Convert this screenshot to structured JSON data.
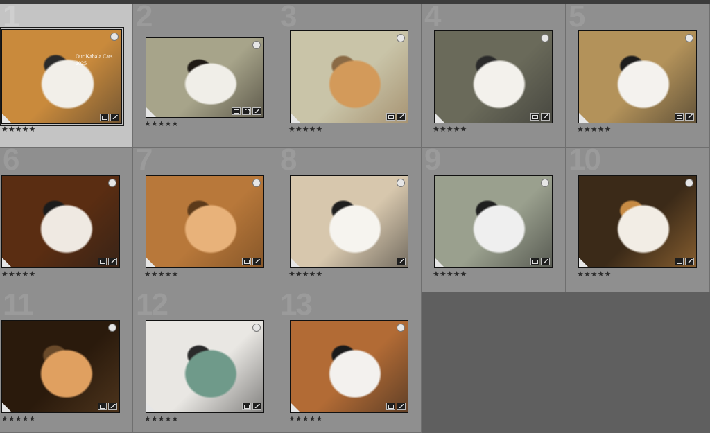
{
  "grid": {
    "cells": [
      {
        "num": "1",
        "rating": "★★★★★",
        "selected": true,
        "caption": [
          "Our Kahala Cats",
          "2025"
        ],
        "badges": [
          "crop",
          "edit"
        ],
        "palette": [
          "#c98a3c",
          "#f2efe9",
          "#2a2a2a"
        ]
      },
      {
        "num": "2",
        "rating": "★★★★★",
        "badges": [
          "crop",
          "extra",
          "edit"
        ],
        "palette": [
          "#a7a48a",
          "#f0eee8",
          "#1f1a15"
        ]
      },
      {
        "num": "3",
        "rating": "★★★★★",
        "badges": [
          "crop",
          "edit"
        ],
        "palette": [
          "#c9c4a8",
          "#d39a5a",
          "#8a6a45"
        ]
      },
      {
        "num": "4",
        "rating": "★★★★★",
        "badges": [
          "crop",
          "edit"
        ],
        "palette": [
          "#6a6a5a",
          "#f3f1ec",
          "#2a2a2a"
        ]
      },
      {
        "num": "5",
        "rating": "★★★★★",
        "badges": [
          "crop",
          "edit"
        ],
        "palette": [
          "#b3925a",
          "#f4f2ee",
          "#1c1c1c"
        ]
      },
      {
        "num": "6",
        "rating": "★★★★★",
        "badges": [
          "crop",
          "edit"
        ],
        "palette": [
          "#5a2d12",
          "#efe9e2",
          "#1b1b1b"
        ]
      },
      {
        "num": "7",
        "rating": "★★★★★",
        "badges": [
          "crop",
          "edit"
        ],
        "palette": [
          "#b8783a",
          "#e8b27a",
          "#5c3a1a"
        ]
      },
      {
        "num": "8",
        "rating": "★★★★★",
        "badges": [
          "edit"
        ],
        "palette": [
          "#d7c7ad",
          "#f6f4ef",
          "#1f1f1f"
        ]
      },
      {
        "num": "9",
        "rating": "★★★★★",
        "badges": [
          "crop",
          "edit"
        ],
        "palette": [
          "#9aa08e",
          "#efefef",
          "#1f1f1f"
        ]
      },
      {
        "num": "10",
        "rating": "★★★★★",
        "badges": [
          "crop",
          "edit"
        ],
        "palette": [
          "#3b2a18",
          "#f2ede5",
          "#c78b44"
        ]
      },
      {
        "num": "11",
        "rating": "★★★★★",
        "badges": [
          "crop",
          "edit"
        ],
        "palette": [
          "#2a1a0c",
          "#e0a060",
          "#6a4a2a"
        ]
      },
      {
        "num": "12",
        "rating": "★★★★★",
        "badges": [
          "crop",
          "edit"
        ],
        "palette": [
          "#e9e7e3",
          "#6f9a8a",
          "#2a2a2a"
        ]
      },
      {
        "num": "13",
        "rating": "★★★★★",
        "badges": [
          "crop",
          "edit"
        ],
        "palette": [
          "#b26b35",
          "#f3f1ee",
          "#1a1a1a"
        ]
      }
    ]
  }
}
